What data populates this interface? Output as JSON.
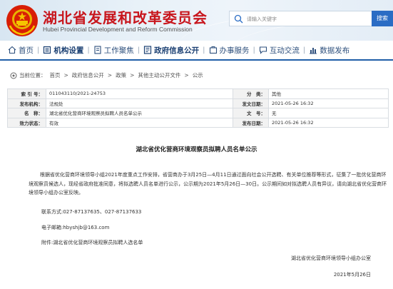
{
  "header": {
    "title": "湖北省发展和改革委员会",
    "subtitle": "Hubei Provincial Development and Reform Commission",
    "search_placeholder": "请输入关键字",
    "search_button": "搜索",
    "brand_color": "#c8161d",
    "accent_color": "#2a6cc4"
  },
  "nav": {
    "items": [
      {
        "label": "首页",
        "icon": "home-icon"
      },
      {
        "label": "机构设置",
        "icon": "org-icon"
      },
      {
        "label": "工作聚焦",
        "icon": "doc-icon"
      },
      {
        "label": "政府信息公开",
        "icon": "info-icon"
      },
      {
        "label": "办事服务",
        "icon": "service-icon"
      },
      {
        "label": "互动交流",
        "icon": "chat-icon"
      },
      {
        "label": "数据发布",
        "icon": "chart-icon"
      }
    ]
  },
  "breadcrumb": {
    "prefix": "当前位置：",
    "items": [
      "首页",
      "政府信息公开",
      "政策",
      "其他主动公开文件",
      "公示"
    ],
    "separator": ">"
  },
  "meta": {
    "index_no_label": "索 引 号：",
    "index_no": "011043110/2021-24753",
    "category_label": "分　类：",
    "category": "其他",
    "issuer_label": "发布机构：",
    "issuer": "法规处",
    "pub_date_label": "发文日期：",
    "pub_date": "2021-05-26 16:32",
    "name_label": "名　称：",
    "name": "湖北省优化营商环境观察员拟聘人员名单公示",
    "doc_no_label": "文　号：",
    "doc_no": "无",
    "status_label": "效力状态：",
    "status": "有效",
    "release_date_label": "发布日期：",
    "release_date": "2021-05-26 16:32"
  },
  "article": {
    "title": "湖北省优化营商环境观察员拟聘人员名单公示",
    "body": "根据省优化营商环境领导小组2021年度重点工作安排，省营商办于3月25日—4月11日通过面向社会公开选聘、有关单位推荐等形式，征集了一批优化营商环境观察员候选人，现经省政府批准同意，将拟选聘人员名单进行公示，公示期为2021年5月26日—30日。公示期间如对拟选聘人员有异议，请向湖北省优化营商环境领导小组办公室反映。",
    "phone": "联系方式:027-87137635、027-87137633",
    "email": "电子邮箱:hbyshjb@163.com",
    "attachment": "附件:湖北省优化营商环境观察员拟聘人选名单",
    "signer": "湖北省优化营商环境领导小组办公室",
    "date": "2021年5月26日"
  }
}
